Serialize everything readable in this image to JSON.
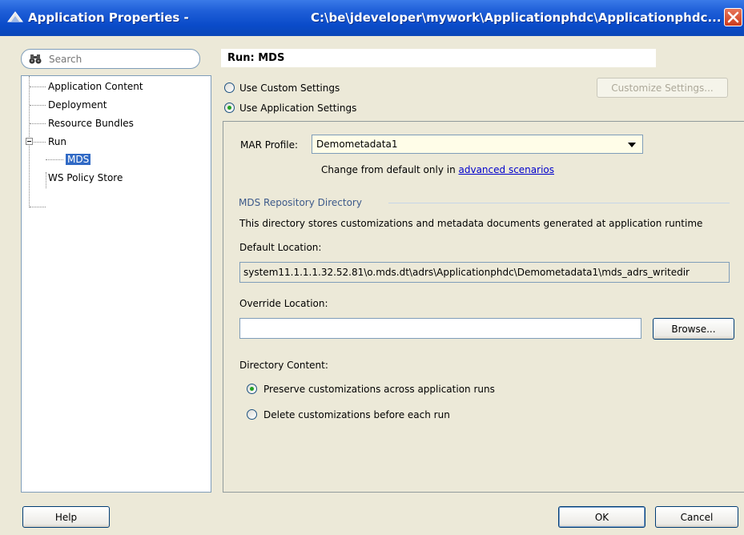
{
  "window": {
    "title_left": "Application Properties -",
    "title_path": "C:\\be\\jdeveloper\\mywork\\Applicationphdc\\Applicationphdc..."
  },
  "nav": {
    "search_placeholder": "Search",
    "tree": [
      {
        "label": "Application Content"
      },
      {
        "label": "Deployment"
      },
      {
        "label": "Resource Bundles"
      },
      {
        "label": "Run",
        "expanded": true
      },
      {
        "label": "MDS",
        "selected": true
      },
      {
        "label": "WS Policy Store"
      }
    ]
  },
  "panel": {
    "title": "Run: MDS",
    "use_custom": {
      "label": "Use Custom Settings",
      "selected": false
    },
    "use_app": {
      "label": "Use Application Settings",
      "selected": true
    },
    "customize_button": "Customize Settings...",
    "mar_profile": {
      "label": "MAR Profile:",
      "value": "Demometadata1",
      "hint_text": "Change from default only in",
      "hint_link": "advanced scenarios"
    },
    "repository": {
      "section_title": "MDS Repository Directory",
      "description": "This directory stores customizations and metadata documents generated at application runtime",
      "default_location_label": "Default Location:",
      "default_location_value": "system11.1.1.1.32.52.81\\o.mds.dt\\adrs\\Applicationphdc\\Demometadata1\\mds_adrs_writedir",
      "override_location_label": "Override Location:",
      "override_location_value": "",
      "browse_button": "Browse..."
    },
    "directory_content": {
      "label": "Directory Content:",
      "preserve": {
        "label": "Preserve customizations across application runs",
        "selected": true
      },
      "delete": {
        "label": "Delete customizations before each run",
        "selected": false
      }
    }
  },
  "footer": {
    "help": "Help",
    "ok": "OK",
    "cancel": "Cancel"
  },
  "colors": {
    "titlebar": "#0a4bc9",
    "background": "#ece9d8",
    "selection": "#316ac5",
    "link": "#0000cc",
    "radio_dot": "#21a121",
    "close_button": "#cc3b1c"
  }
}
